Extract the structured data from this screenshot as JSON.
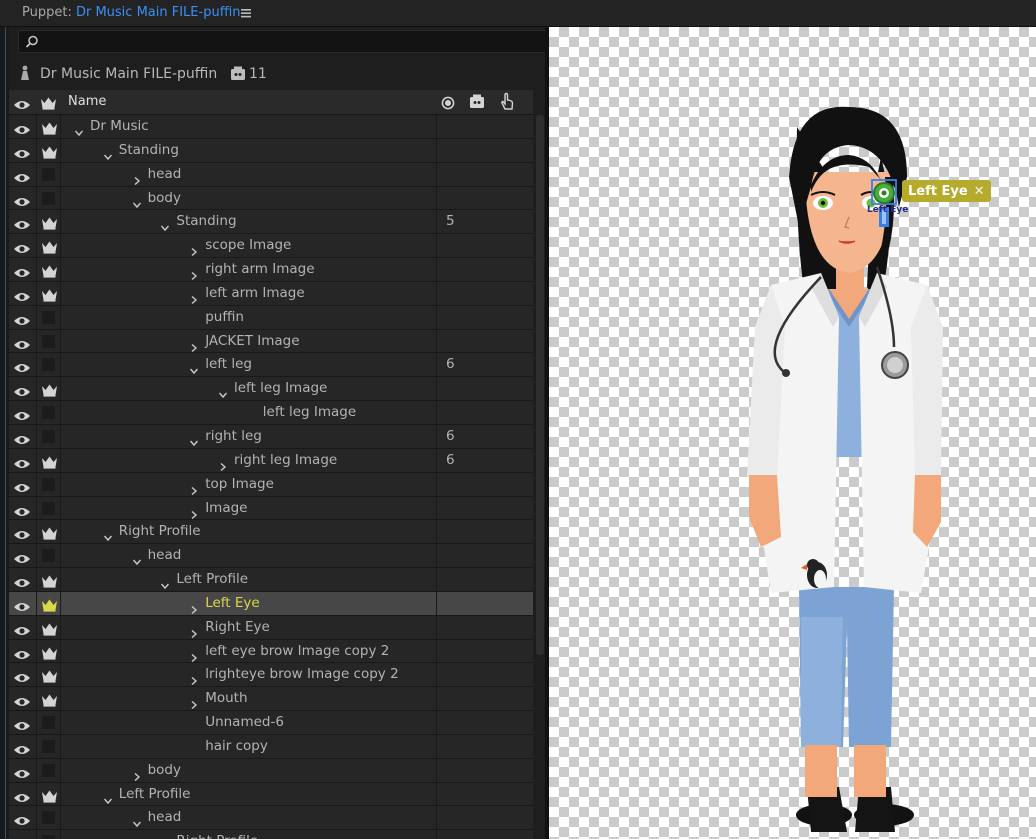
{
  "window": {
    "title_prefix": "Puppet: ",
    "title_name": "Dr Music Main FILE-puffin"
  },
  "search": {
    "placeholder": ""
  },
  "puppet": {
    "name": "Dr Music Main FILE-puffin",
    "count": "11"
  },
  "columns": {
    "name": "Name"
  },
  "rows": [
    {
      "label": "Dr Music",
      "depth": 0,
      "expand": "down",
      "crown": true,
      "count": ""
    },
    {
      "label": "Standing",
      "depth": 1,
      "expand": "down",
      "crown": true,
      "count": ""
    },
    {
      "label": "head",
      "depth": 2,
      "expand": "right",
      "crown": false,
      "count": ""
    },
    {
      "label": "body",
      "depth": 2,
      "expand": "down",
      "crown": false,
      "count": ""
    },
    {
      "label": "Standing",
      "depth": 3,
      "expand": "down",
      "crown": true,
      "count": "5"
    },
    {
      "label": "scope Image",
      "depth": 4,
      "expand": "right",
      "crown": true,
      "count": ""
    },
    {
      "label": "right arm Image",
      "depth": 4,
      "expand": "right",
      "crown": true,
      "count": ""
    },
    {
      "label": "left arm Image",
      "depth": 4,
      "expand": "right",
      "crown": true,
      "count": ""
    },
    {
      "label": "puffin",
      "depth": 4,
      "expand": "none",
      "crown": false,
      "count": ""
    },
    {
      "label": "JACKET Image",
      "depth": 4,
      "expand": "right",
      "crown": false,
      "count": ""
    },
    {
      "label": "left leg",
      "depth": 4,
      "expand": "down",
      "crown": false,
      "count": "6"
    },
    {
      "label": "left leg Image",
      "depth": 5,
      "expand": "down",
      "crown": true,
      "count": ""
    },
    {
      "label": "left leg Image",
      "depth": 6,
      "expand": "none",
      "crown": false,
      "count": ""
    },
    {
      "label": "right leg",
      "depth": 4,
      "expand": "down",
      "crown": false,
      "count": "6"
    },
    {
      "label": "right leg Image",
      "depth": 5,
      "expand": "right",
      "crown": true,
      "count": "6"
    },
    {
      "label": "top Image",
      "depth": 4,
      "expand": "right",
      "crown": false,
      "count": ""
    },
    {
      "label": "Image",
      "depth": 4,
      "expand": "right",
      "crown": false,
      "count": ""
    },
    {
      "label": "Right Profile",
      "depth": 1,
      "expand": "down",
      "crown": true,
      "count": ""
    },
    {
      "label": "head",
      "depth": 2,
      "expand": "down",
      "crown": false,
      "count": ""
    },
    {
      "label": "Left Profile",
      "depth": 3,
      "expand": "down",
      "crown": true,
      "count": ""
    },
    {
      "label": "Left Eye",
      "depth": 4,
      "expand": "right",
      "crown": true,
      "count": "",
      "selected": true
    },
    {
      "label": "Right Eye",
      "depth": 4,
      "expand": "right",
      "crown": true,
      "count": ""
    },
    {
      "label": "left eye brow Image copy 2",
      "depth": 4,
      "expand": "right",
      "crown": true,
      "count": ""
    },
    {
      "label": "lrighteye brow Image copy 2",
      "depth": 4,
      "expand": "right",
      "crown": true,
      "count": ""
    },
    {
      "label": "Mouth",
      "depth": 4,
      "expand": "right",
      "crown": true,
      "count": ""
    },
    {
      "label": "Unnamed-6",
      "depth": 4,
      "expand": "none",
      "crown": false,
      "count": ""
    },
    {
      "label": "hair copy",
      "depth": 4,
      "expand": "none",
      "crown": false,
      "count": ""
    },
    {
      "label": "body",
      "depth": 2,
      "expand": "right",
      "crown": false,
      "count": ""
    },
    {
      "label": "Left Profile",
      "depth": 1,
      "expand": "down",
      "crown": true,
      "count": ""
    },
    {
      "label": "head",
      "depth": 2,
      "expand": "down",
      "crown": false,
      "count": ""
    },
    {
      "label": "Right Profile",
      "depth": 3,
      "expand": "down",
      "crown": false,
      "count": ""
    }
  ],
  "canvas": {
    "tag_label": "Left Eye",
    "handle_label": "Left Eye"
  },
  "colors": {
    "accent_blue": "#3d8ff7",
    "selected_yellow": "#d8d84a",
    "tag_bg": "#b6ab2c"
  }
}
